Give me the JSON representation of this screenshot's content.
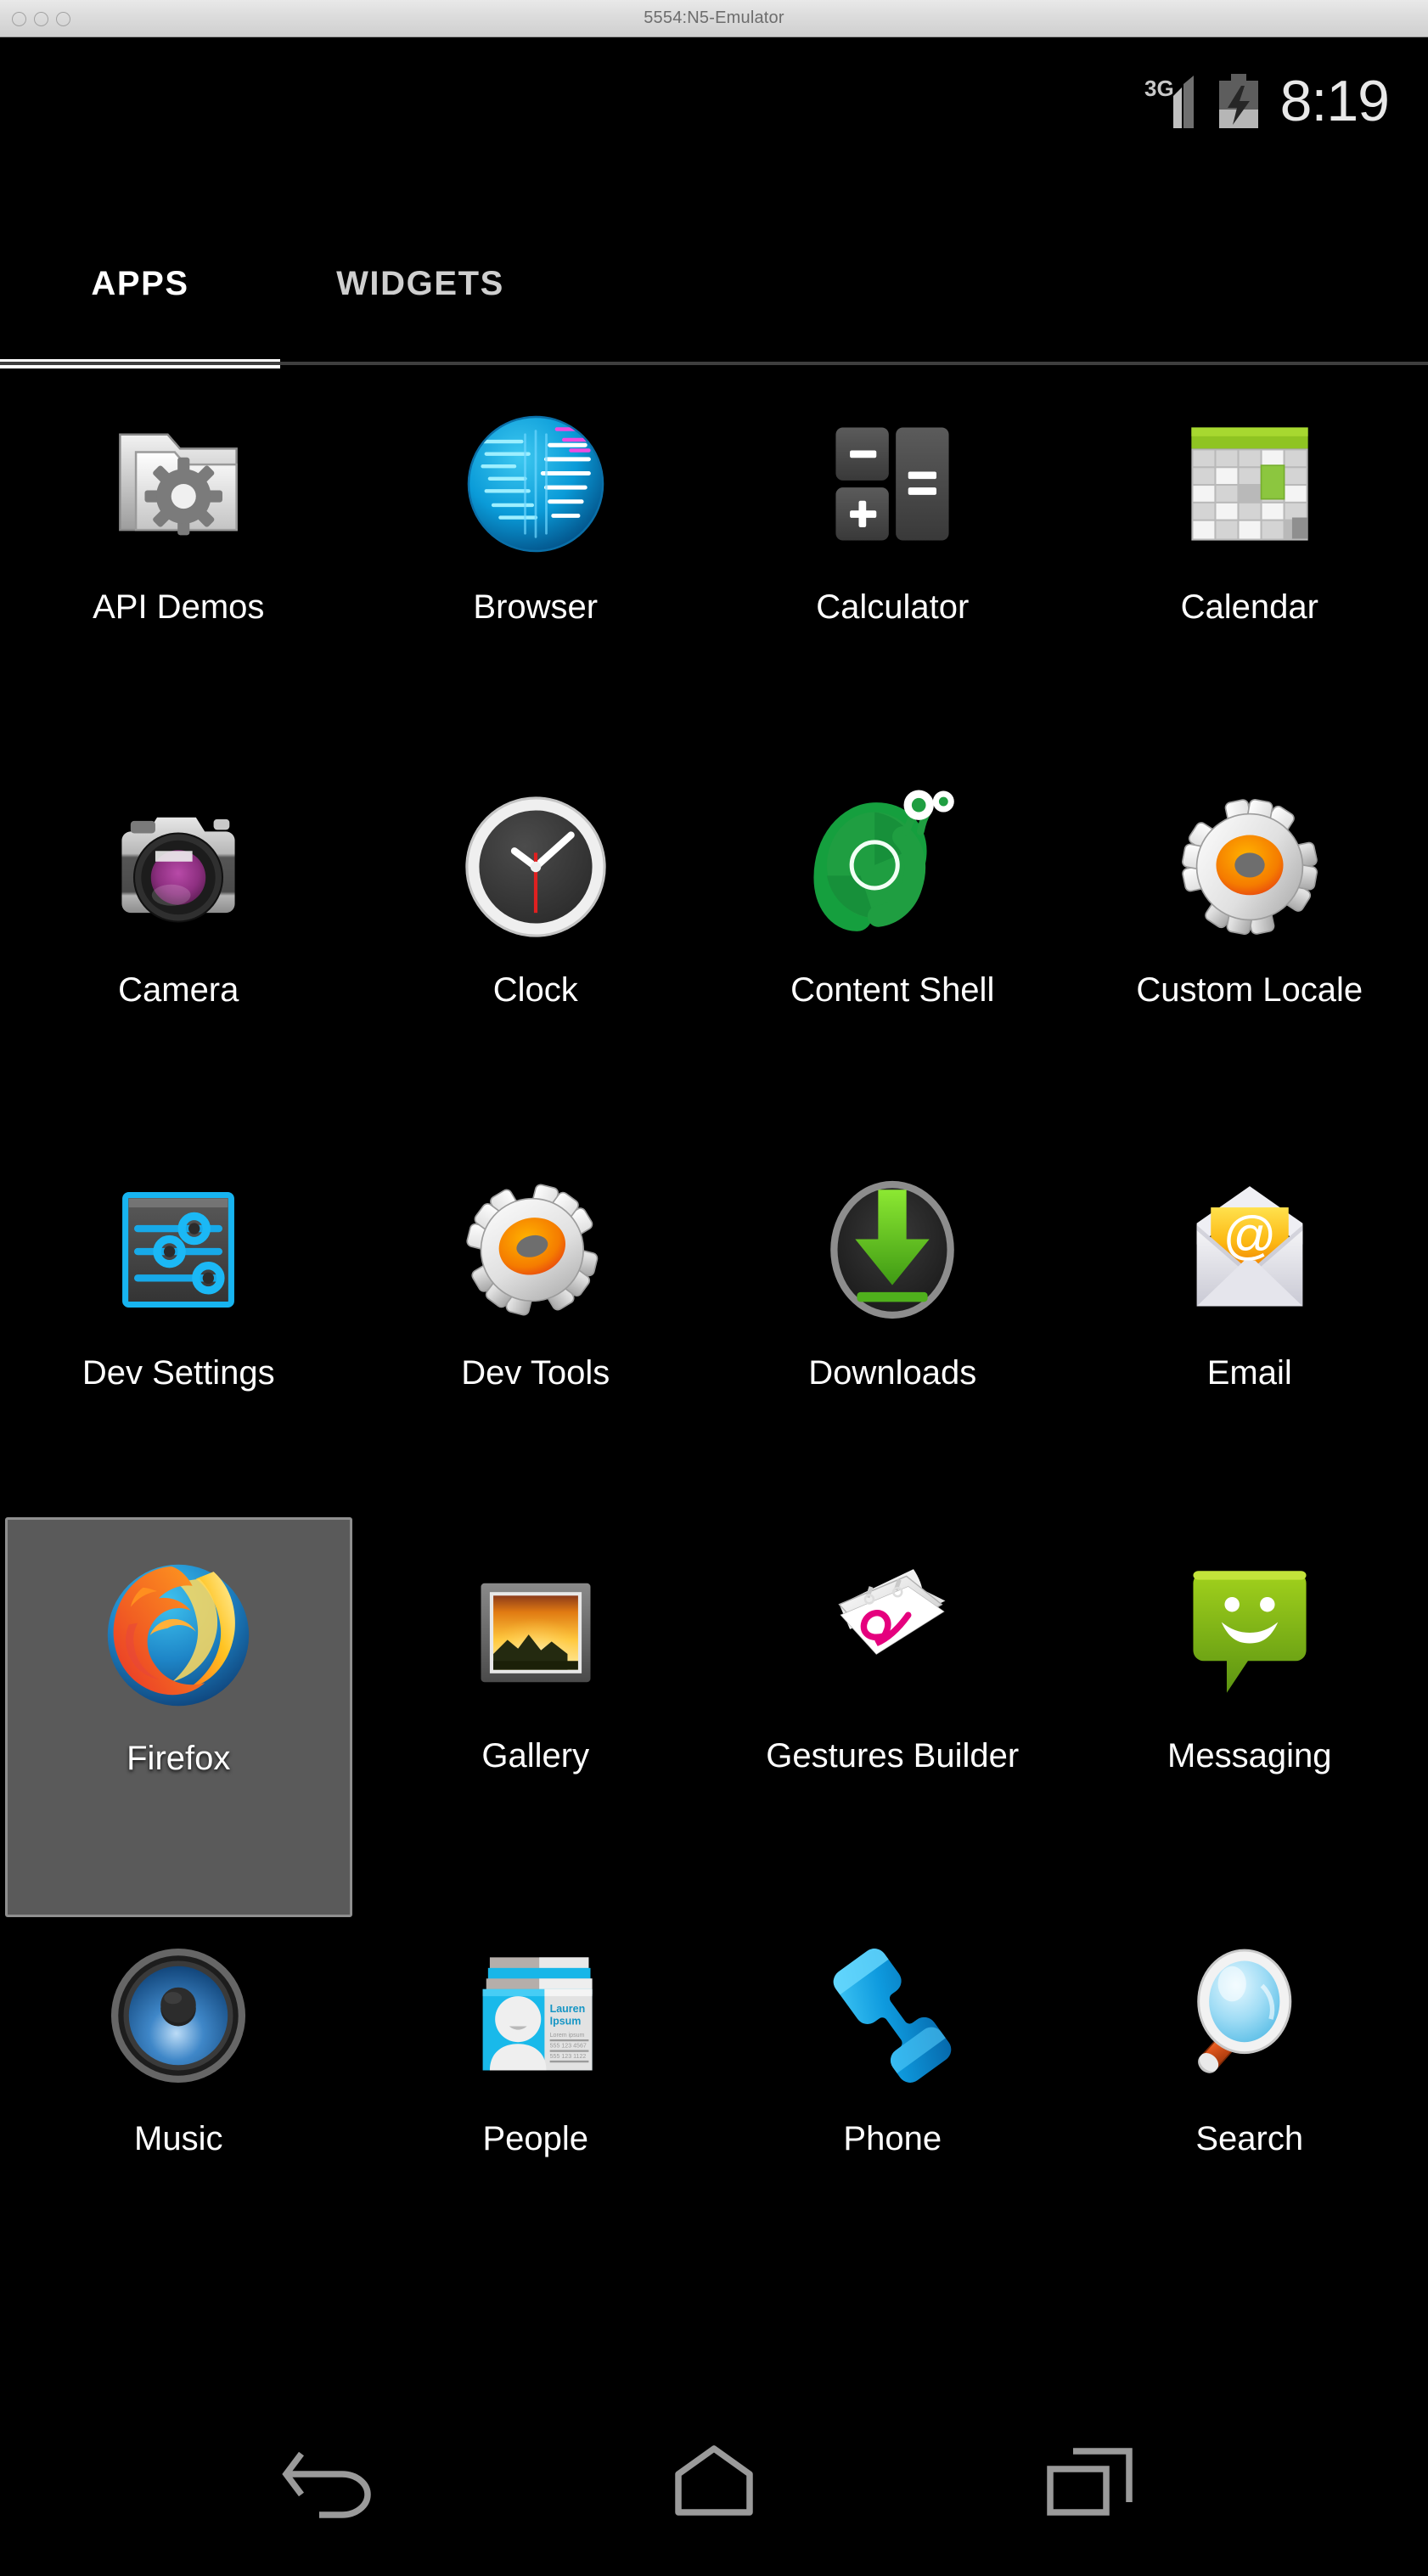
{
  "window": {
    "title": "5554:N5-Emulator",
    "buttons": [
      "close",
      "minimize",
      "zoom"
    ]
  },
  "status_bar": {
    "network_label": "3G",
    "signal_icon": "signal-bars-icon",
    "battery_icon": "battery-charging-icon",
    "clock": "8:19"
  },
  "tabs": [
    {
      "id": "apps",
      "label": "APPS",
      "active": true
    },
    {
      "id": "widgets",
      "label": "WIDGETS",
      "active": false
    }
  ],
  "app_drawer": {
    "columns": 4,
    "apps": [
      {
        "label": "API Demos",
        "icon": "folder-gear-icon",
        "selected": false
      },
      {
        "label": "Browser",
        "icon": "globe-icon",
        "selected": false
      },
      {
        "label": "Calculator",
        "icon": "calculator-keys-icon",
        "selected": false
      },
      {
        "label": "Calendar",
        "icon": "calendar-grid-icon",
        "selected": false
      },
      {
        "label": "Camera",
        "icon": "camera-icon",
        "selected": false
      },
      {
        "label": "Clock",
        "icon": "analog-clock-icon",
        "selected": false
      },
      {
        "label": "Content Shell",
        "icon": "green-snail-icon",
        "selected": false
      },
      {
        "label": "Custom Locale",
        "icon": "gear-orange-icon",
        "selected": false
      },
      {
        "label": "Dev Settings",
        "icon": "sliders-icon",
        "selected": false
      },
      {
        "label": "Dev Tools",
        "icon": "gear-orange-icon",
        "selected": false
      },
      {
        "label": "Downloads",
        "icon": "download-arrow-icon",
        "selected": false
      },
      {
        "label": "Email",
        "icon": "envelope-at-icon",
        "selected": false
      },
      {
        "label": "Firefox",
        "icon": "firefox-icon",
        "selected": true
      },
      {
        "label": "Gallery",
        "icon": "picture-frame-icon",
        "selected": false
      },
      {
        "label": "Gestures Builder",
        "icon": "notepad-gesture-icon",
        "selected": false
      },
      {
        "label": "Messaging",
        "icon": "speech-bubble-smiley-icon",
        "selected": false
      },
      {
        "label": "Music",
        "icon": "speaker-icon",
        "selected": false
      },
      {
        "label": "People",
        "icon": "contact-card-icon",
        "selected": false
      },
      {
        "label": "Phone",
        "icon": "phone-handset-icon",
        "selected": false
      },
      {
        "label": "Search",
        "icon": "magnifier-icon",
        "selected": false
      }
    ],
    "contact_card_text": {
      "name": "Lauren Ipsum"
    }
  },
  "nav_bar": {
    "buttons": [
      {
        "id": "back",
        "icon": "back-arrow-icon"
      },
      {
        "id": "home",
        "icon": "home-icon"
      },
      {
        "id": "recents",
        "icon": "recents-icon"
      }
    ]
  },
  "colors": {
    "background": "#000000",
    "tab_active": "#ffffff",
    "tab_inactive": "#cfcfcf",
    "selection_bg": "#5a5a5a",
    "selection_border": "#8f8f8f",
    "status_text": "#e8e8e8",
    "nav_icon": "#9a9a9a"
  }
}
